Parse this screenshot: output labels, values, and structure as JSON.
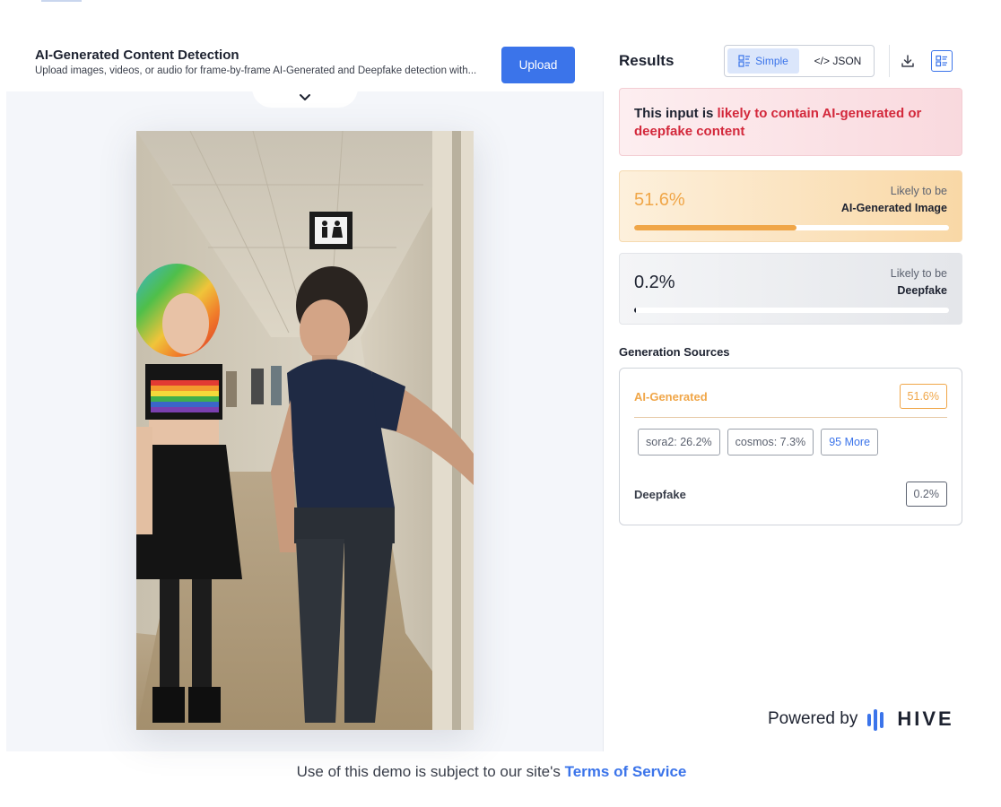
{
  "left": {
    "title": "AI-Generated Content Detection",
    "subtitle": "Upload images, videos, or audio for frame-by-frame AI-Generated and Deepfake detection with...",
    "upload_label": "Upload",
    "collapse_icon": "chevron-down-icon"
  },
  "results": {
    "title": "Results",
    "toggle": {
      "simple": "Simple",
      "json": "</> JSON",
      "active": "simple"
    },
    "icons": [
      "download-icon",
      "list-view-icon"
    ]
  },
  "verdict": {
    "prefix": "This input is ",
    "highlight": "likely to contain AI-generated or deepfake content"
  },
  "scores": [
    {
      "percent": "51.6%",
      "fraction": 0.516,
      "label_top": "Likely to be",
      "label_bottom": "AI-Generated Image"
    },
    {
      "percent": "0.2%",
      "fraction": 0.002,
      "label_top": "Likely to be",
      "label_bottom": "Deepfake"
    }
  ],
  "generation_sources": {
    "title": "Generation Sources",
    "ai_label": "AI-Generated",
    "ai_percent": "51.6%",
    "chips": [
      "sora2: 26.2%",
      "cosmos: 7.3%"
    ],
    "more_label": "95 More",
    "deepfake_label": "Deepfake",
    "deepfake_percent": "0.2%"
  },
  "branding": {
    "powered_by": "Powered by",
    "brand": "HIVE"
  },
  "footer": {
    "text": "Use of this demo is subject to our site's ",
    "link": "Terms of Service"
  },
  "colors": {
    "accent": "#3b74ea",
    "ai": "#f0a648",
    "danger": "#d3283b"
  }
}
